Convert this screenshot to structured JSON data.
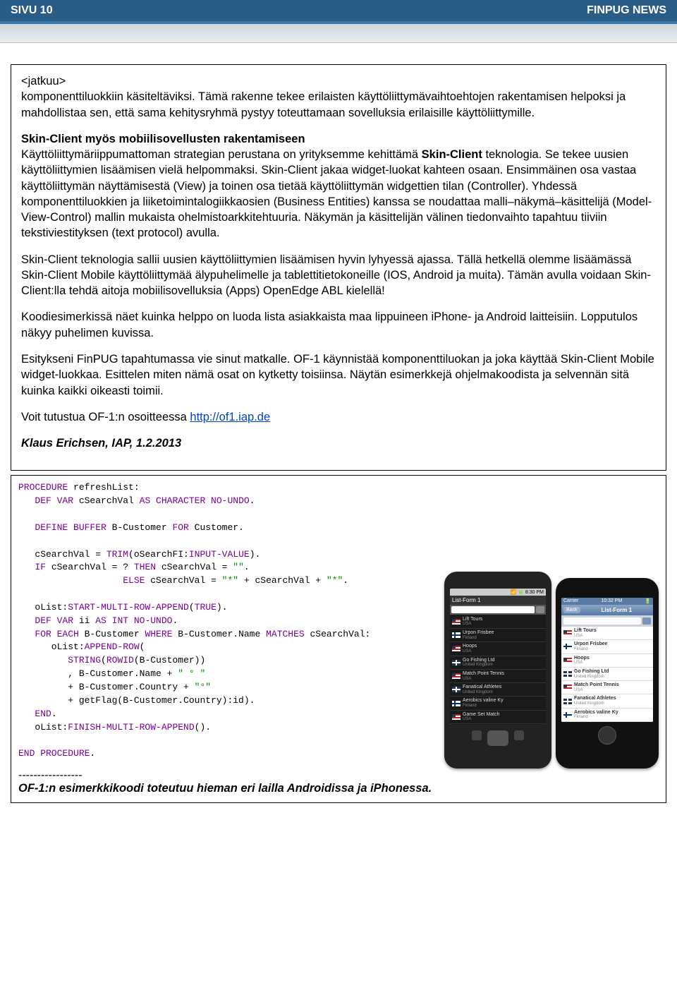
{
  "header": {
    "page_label": "SIVU 10",
    "publication": "FINPUG NEWS"
  },
  "article": {
    "continuation_tag": "<jatkuu>",
    "intro": "komponenttiluokkiin käsiteltäviksi. Tämä rakenne tekee erilaisten käyttöliittymävaihtoehtojen rakentamisen helpoksi ja mahdollistaa sen, että sama kehitysryhmä pystyy toteuttamaan sovelluksia erilaisille käyttöliittymille.",
    "heading_bold": "Skin-Client myös mobiilisovellusten rakentamiseen",
    "para2_part1": "Käyttöliittymäriippumattoman strategian perustana on yrityksemme kehittämä ",
    "para2_bold": "Skin-Client",
    "para2_part2": " teknologia. Se tekee uusien käyttöliittymien lisäämisen vielä helpommaksi. Skin-Client jakaa widget-luokat kahteen osaan. Ensimmäinen osa vastaa käyttöliittymän näyttämisestä (View) ja toinen osa tietää käyttöliittymän widgettien tilan (Controller). Yhdessä komponenttiluokkien ja liiketoimintalogiikkaosien (Business Entities) kanssa se noudattaa malli–näkymä–käsittelijä (Model-View-Control) mallin mukaista ohelmistoarkkitehtuuria. Näkymän ja käsittelijän välinen tiedonvaihto tapahtuu tiiviin tekstiviestityksen (text protocol) avulla.",
    "para3": "Skin-Client teknologia sallii uusien käyttöliittymien lisäämisen hyvin lyhyessä ajassa. Tällä hetkellä olemme lisäämässä Skin-Client Mobile käyttöliittymää älypuhelimelle ja tablettitietokoneille (IOS, Android ja muita). Tämän avulla voidaan Skin-Client:lla tehdä aitoja mobiilisovelluksia (Apps) OpenEdge ABL kielellä!",
    "para4": "Koodiesimerkissä näet kuinka helppo on luoda lista asiakkaista maa lippuineen iPhone- ja Android laitteisiin. Lopputulos näkyy puhelimen kuvissa.",
    "para5": "Esitykseni FinPUG tapahtumassa vie sinut matkalle. OF-1 käynnistää komponenttiluokan ja joka käyttää Skin-Client Mobile widget-luokkaa. Esittelen miten nämä osat on kytketty toisiinsa. Näytän esimerkkejä ohjelmakoodista ja selvennän sitä kuinka kaikki oikeasti toimii.",
    "para6_text": "Voit tutustua OF-1:n osoitteessa ",
    "para6_link": "http://of1.iap.de",
    "signature": "Klaus Erichsen, IAP, 1.2.2013"
  },
  "code": {
    "l1a": "PROCEDURE",
    "l1b": " refreshList:",
    "l2a": "   DEF VAR",
    "l2b": " cSearchVal ",
    "l2c": "AS CHARACTER NO-UNDO",
    "l2d": ".",
    "l3a": "   DEFINE BUFFER",
    "l3b": " B-Customer ",
    "l3c": "FOR",
    "l3d": " Customer.",
    "l4a": "   cSearchVal = ",
    "l4b": "TRIM",
    "l4c": "(oSearchFI:",
    "l4d": "INPUT-VALUE",
    "l4e": ").",
    "l5a": "   IF",
    "l5b": " cSearchVal = ? ",
    "l5c": "THEN",
    "l5d": " cSearchVal = ",
    "l5e": "\"\"",
    "l5f": ".",
    "l6a": "                   ELSE",
    "l6b": " cSearchVal = ",
    "l6c": "\"*\"",
    "l6d": " + cSearchVal + ",
    "l6e": "\"*\"",
    "l6f": ".",
    "l7a": "   oList:",
    "l7b": "START-MULTI-ROW-APPEND",
    "l7c": "(",
    "l7d": "TRUE",
    "l7e": ").",
    "l8a": "   DEF VAR",
    "l8b": " ii ",
    "l8c": "AS INT NO-UNDO",
    "l8d": ".",
    "l9a": "   FOR EACH",
    "l9b": " B-Customer ",
    "l9c": "WHERE",
    "l9d": " B-Customer.Name ",
    "l9e": "MATCHES",
    "l9f": " cSearchVal:",
    "l10a": "      oList:",
    "l10b": "APPEND-ROW",
    "l10c": "(",
    "l11a": "         STRING",
    "l11b": "(",
    "l11c": "ROWID",
    "l11d": "(B-Customer))",
    "l12a": "         , B-Customer.Name + ",
    "l12b": "\" ° \"",
    "l13a": "         + B-Customer.Country + ",
    "l13b": "\"°\"",
    "l14": "         + getFlag(B-Customer.Country):id).",
    "l15a": "   END",
    "l15b": ".",
    "l16a": "   oList:",
    "l16b": "FINISH-MULTI-ROW-APPEND",
    "l16c": "().",
    "l17a": "END PROCEDURE",
    "l17b": "."
  },
  "phones": {
    "android": {
      "status": "📶 🔋 8:30 PM",
      "header_left": "List-Form 1",
      "list": [
        {
          "name": "Lift Tours",
          "country": "USA",
          "flag": "usa"
        },
        {
          "name": "Urpon Frisbee",
          "country": "Finland",
          "flag": "fin"
        },
        {
          "name": "Hoops",
          "country": "USA",
          "flag": "usa"
        },
        {
          "name": "Go Fishing Ltd",
          "country": "United Kingdom",
          "flag": "uk"
        },
        {
          "name": "Match Point Tennis",
          "country": "USA",
          "flag": "usa"
        },
        {
          "name": "Fanatical Athletes",
          "country": "United Kingdom",
          "flag": "uk"
        },
        {
          "name": "Aerobics valine Ky",
          "country": "Finland",
          "flag": "fin"
        },
        {
          "name": "Game Set Match",
          "country": "USA",
          "flag": "usa"
        }
      ]
    },
    "iphone": {
      "carrier": "Carrier",
      "time": "10:32 PM",
      "back": "Back",
      "title": "List-Form 1",
      "list": [
        {
          "name": "Lift Tours",
          "country": "USA",
          "flag": "usa"
        },
        {
          "name": "Urpon Frisbee",
          "country": "Finland",
          "flag": "fin"
        },
        {
          "name": "Hoops",
          "country": "USA",
          "flag": "usa"
        },
        {
          "name": "Go Fishing Ltd",
          "country": "United Kingdom",
          "flag": "uk"
        },
        {
          "name": "Match Point Tennis",
          "country": "USA",
          "flag": "usa"
        },
        {
          "name": "Fanatical Athletes",
          "country": "United Kingdom",
          "flag": "uk"
        },
        {
          "name": "Aerobics valine Ky",
          "country": "Finland",
          "flag": "fin"
        }
      ]
    }
  },
  "footer": {
    "dashes": "-----------------",
    "caption": "OF-1:n esimerkkikoodi toteutuu hieman eri lailla Androidissa ja iPhonessa."
  }
}
